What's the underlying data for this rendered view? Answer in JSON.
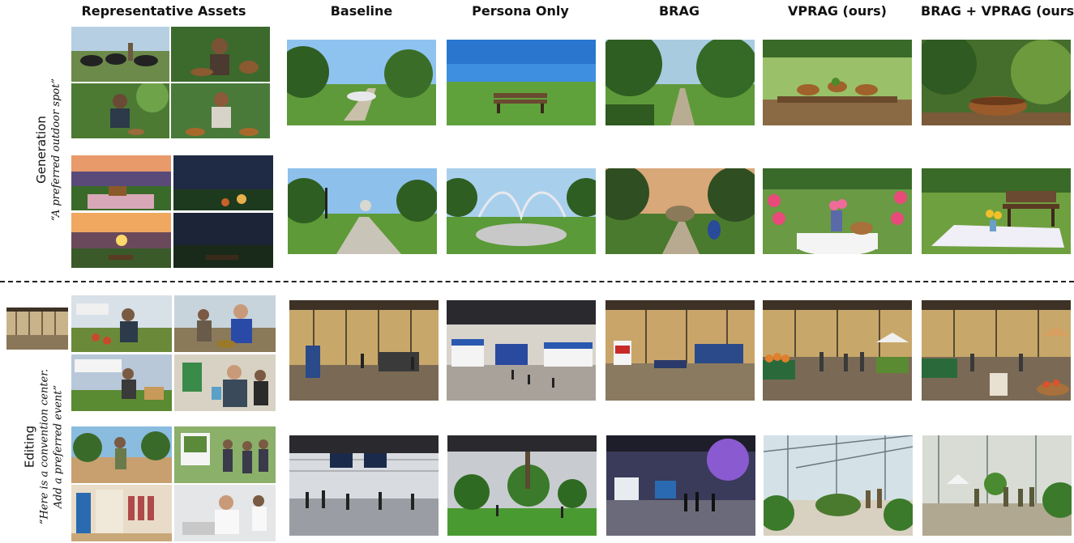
{
  "columns": {
    "assets": "Representative Assets",
    "baseline": "Baseline",
    "persona": "Persona Only",
    "brag": "BRAG",
    "vprag": "VPRAG (ours)",
    "combo": "BRAG + VPRAG (ours)"
  },
  "rows": {
    "generation": {
      "task": "Generation",
      "prompt": "“A preferred outdoor spot”"
    },
    "editing": {
      "task": "Editing",
      "prompt_line1": "“Here is a convention center.",
      "prompt_line2": "Add a preferred event”"
    }
  },
  "colors": {
    "sky": "#8fc3ef",
    "grass": "#5f9a3a",
    "foliage": "#2f5e22",
    "dusk": "#3a2f5a",
    "hall": "#b99a6a",
    "floor": "#7a6a55"
  }
}
